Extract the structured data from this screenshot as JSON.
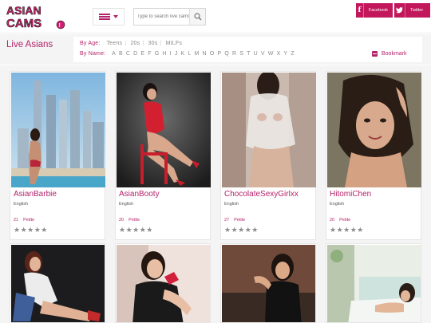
{
  "header": {
    "logo_alt": "ASIAN CAMS",
    "search": {
      "placeholder": "Type to search live cams",
      "value": ""
    },
    "social": {
      "facebook_label": "Facebook",
      "twitter_label": "Twitter"
    }
  },
  "filters": {
    "title": "Live Asians",
    "by_age_label": "By Age:",
    "age_options": [
      "Teens",
      "20s",
      "30s",
      "MILFs"
    ],
    "by_name_label": "By Name:",
    "letters": [
      "A",
      "B",
      "C",
      "D",
      "E",
      "F",
      "G",
      "H",
      "I",
      "J",
      "K",
      "L",
      "M",
      "N",
      "O",
      "P",
      "Q",
      "R",
      "S",
      "T",
      "U",
      "V",
      "W",
      "X",
      "Y",
      "Z"
    ],
    "bookmark_label": "Bookmark"
  },
  "cards": [
    {
      "name": "AsianBarbie",
      "language": "English",
      "age": "21",
      "tag": "Petite",
      "rating": "★★★★★"
    },
    {
      "name": "AsianBooty",
      "language": "English",
      "age": "20",
      "tag": "Petite",
      "rating": "★★★★★"
    },
    {
      "name": "ChocolateSexyGirlxx",
      "language": "English",
      "age": "27",
      "tag": "Petite",
      "rating": "★★★★★"
    },
    {
      "name": "HitomiChen",
      "language": "English",
      "age": "20",
      "tag": "Petite",
      "rating": "★★★★★"
    }
  ],
  "colors": {
    "accent": "#b3236b",
    "facebook": "#c2185b",
    "twitter": "#c2185b",
    "background": "#f4f4f4"
  }
}
